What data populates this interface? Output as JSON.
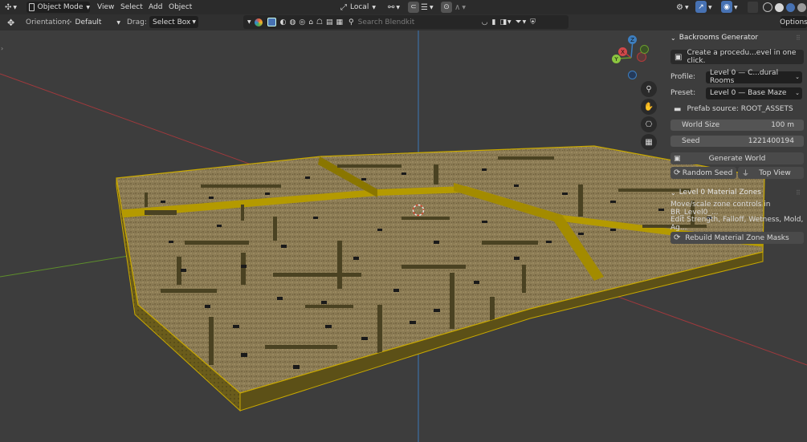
{
  "header": {
    "mode_label": "Object Mode",
    "menus": [
      "View",
      "Select",
      "Add",
      "Object"
    ],
    "transform_space": "Local",
    "options_label": "Options"
  },
  "toolbar": {
    "orientation_label": "Orientation:",
    "orientation_value": "Default",
    "drag_label": "Drag:",
    "drag_value": "Select Box",
    "search_placeholder": "Search Blendkit"
  },
  "sidebar": {
    "generator": {
      "title": "Backrooms Generator",
      "description": "Create a procedu...evel in one click.",
      "profile_label": "Profile:",
      "profile_value": "Level 0 — C...dural Rooms",
      "preset_label": "Preset:",
      "preset_value": "Level 0 — Base Maze",
      "prefab_source": "Prefab source: ROOT_ASSETS",
      "world_size_label": "World Size",
      "world_size_value": "100 m",
      "seed_label": "Seed",
      "seed_value": "1221400194",
      "generate_label": "Generate World",
      "random_seed_label": "Random Seed",
      "top_view_label": "Top View"
    },
    "zones": {
      "title": "Level 0 Material Zones",
      "line1": "Move/scale zone controls in BR_Level0_...",
      "line2": "Edit Strength, Falloff, Wetness, Mold, Ag...",
      "rebuild_label": "Rebuild Material Zone Masks"
    }
  },
  "gizmo": {
    "x_label": "X",
    "y_label": "Y",
    "z_label": "Z"
  },
  "colors": {
    "viewport_bg": "#3d3d3d",
    "floor_top": "#8a7a52",
    "floor_side": "#6e5f00",
    "selection_outline": "#c8a800",
    "axis_x": "#b23a3a",
    "axis_y": "#6a9a2e",
    "axis_z": "#3d7ebf"
  }
}
